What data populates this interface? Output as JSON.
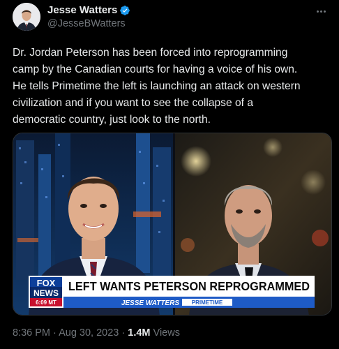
{
  "author": {
    "display_name": "Jesse Watters",
    "handle": "@JesseBWatters",
    "verified": true
  },
  "tweet": {
    "text": "Dr. Jordan Peterson has been forced into reprogramming\ncamp by the Canadian courts for having a voice of his own.\nHe tells Primetime the left is launching an attack on western\ncivilization and if you want to see the collapse of a\ndemocratic country, just look to the north."
  },
  "media": {
    "network_logo_line1": "FOX",
    "network_logo_line2": "NEWS",
    "clock": "6:09 MT",
    "headline": "LEFT WANTS PETERSON REPROGRAMMED",
    "show_name": "JESSE WATTERS",
    "show_tag": "PRIMETIME"
  },
  "meta": {
    "timestamp": "8:36 PM · Aug 30, 2023 · ",
    "views_count": "1.4M",
    "views_label": " Views"
  },
  "colors": {
    "verified": "#1d9bf0",
    "muted": "#71767b",
    "text": "#e7e9ea"
  }
}
